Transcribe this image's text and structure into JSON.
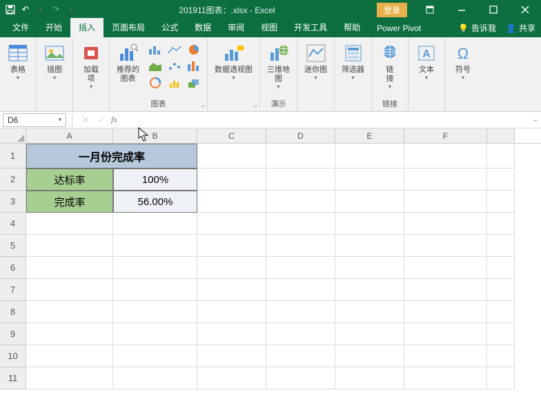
{
  "title": "201911图表：.xlsx  -  Excel",
  "login": "登录",
  "tabs": {
    "file": "文件",
    "home": "开始",
    "insert": "插入",
    "layout": "页面布局",
    "formulas": "公式",
    "data": "数据",
    "review": "审阅",
    "view": "视图",
    "dev": "开发工具",
    "help": "帮助",
    "powerpivot": "Power Pivot"
  },
  "tellme": "告诉我",
  "share": "共享",
  "ribbon": {
    "tables": "表格",
    "illust": "插图",
    "addins": "加载\n项",
    "reccharts": "推荐的\n图表",
    "charts": "图表",
    "pivotchart": "数据透视图",
    "map3d": "三维地\n图",
    "tours": "演示",
    "sparklines": "迷你图",
    "filters": "筛选器",
    "link": "链\n接",
    "links": "链接",
    "text": "文本",
    "symbols": "符号"
  },
  "namebox": "D6",
  "sheet": {
    "cols": {
      "A": "A",
      "B": "B",
      "C": "C",
      "D": "D",
      "E": "E",
      "F": "F"
    },
    "rows": [
      "1",
      "2",
      "3",
      "4",
      "5",
      "6",
      "7",
      "8",
      "9",
      "10",
      "11"
    ],
    "title": "一月份完成率",
    "r2a": "达标率",
    "r2b": "100%",
    "r3a": "完成率",
    "r3b": "56.00%"
  }
}
